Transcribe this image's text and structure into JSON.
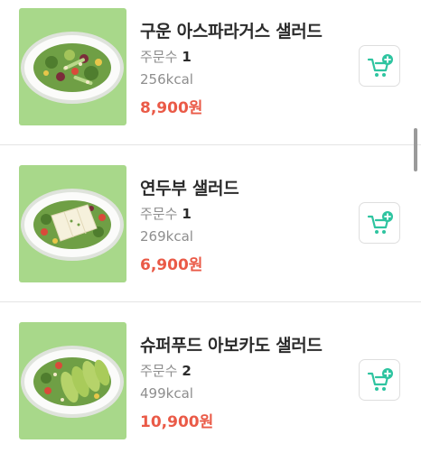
{
  "orders_label": "주문수",
  "colors": {
    "price": "#ea5a47",
    "accent": "#2ec4a0",
    "thumbnail_bg": "#a8d88a"
  },
  "items": [
    {
      "name": "구운 아스파라거스 샐러드",
      "orders": "1",
      "kcal": "256kcal",
      "price": "8,900원",
      "icon": "cart-plus-icon"
    },
    {
      "name": "연두부 샐러드",
      "orders": "1",
      "kcal": "269kcal",
      "price": "6,900원",
      "icon": "cart-plus-icon"
    },
    {
      "name": "슈퍼푸드 아보카도 샐러드",
      "orders": "2",
      "kcal": "499kcal",
      "price": "10,900원",
      "icon": "cart-plus-icon"
    }
  ]
}
